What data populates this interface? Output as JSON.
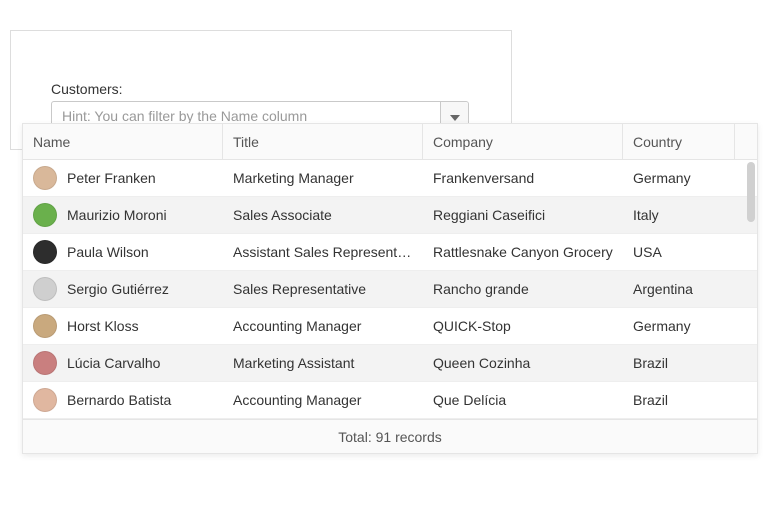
{
  "field": {
    "label": "Customers:",
    "placeholder": "Hint: You can filter by the Name column"
  },
  "grid": {
    "headers": {
      "name": "Name",
      "title": "Title",
      "company": "Company",
      "country": "Country"
    },
    "rows": [
      {
        "name": "Peter Franken",
        "title": "Marketing Manager",
        "company": "Frankenversand",
        "country": "Germany",
        "avatar_color": "#d9b89a"
      },
      {
        "name": "Maurizio Moroni",
        "title": "Sales Associate",
        "company": "Reggiani Caseifici",
        "country": "Italy",
        "avatar_color": "#6ab04c"
      },
      {
        "name": "Paula Wilson",
        "title": "Assistant Sales Represent…",
        "company": "Rattlesnake Canyon Grocery",
        "country": "USA",
        "avatar_color": "#2d2d2d"
      },
      {
        "name": "Sergio Gutiérrez",
        "title": "Sales Representative",
        "company": "Rancho grande",
        "country": "Argentina",
        "avatar_color": "#cfcfcf"
      },
      {
        "name": "Horst Kloss",
        "title": "Accounting Manager",
        "company": "QUICK-Stop",
        "country": "Germany",
        "avatar_color": "#c9a97e"
      },
      {
        "name": "Lúcia Carvalho",
        "title": "Marketing Assistant",
        "company": "Queen Cozinha",
        "country": "Brazil",
        "avatar_color": "#c97f7f"
      },
      {
        "name": "Bernardo Batista",
        "title": "Accounting Manager",
        "company": "Que Delícia",
        "country": "Brazil",
        "avatar_color": "#e0b7a0"
      }
    ],
    "footer": "Total: 91 records",
    "total_records": 91
  }
}
